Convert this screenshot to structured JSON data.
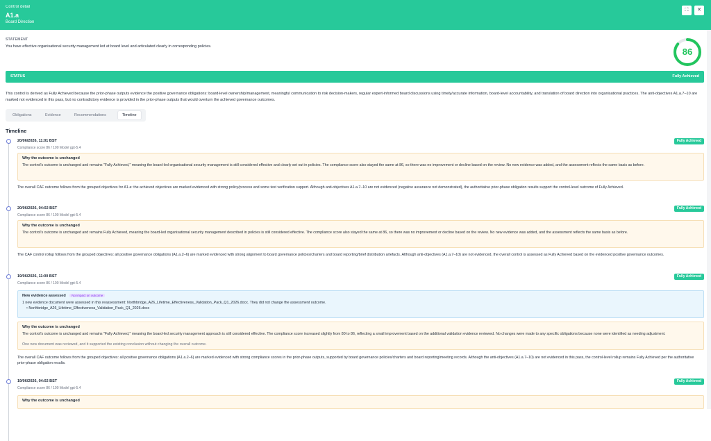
{
  "header": {
    "kicker": "Control detail",
    "title": "A1.a",
    "subtitle": "Board Direction",
    "expand_icon": "expand-icon",
    "close_icon": "close-icon"
  },
  "statement": {
    "label": "STATEMENT",
    "text": "You have effective organisational security management led at board level and articulated clearly in corresponding policies."
  },
  "score": {
    "value": "86",
    "fraction": 0.86,
    "color": "#22c55e"
  },
  "status": {
    "label": "STATUS",
    "value": "Fully Achieved"
  },
  "summary": "This control is derived as Fully Achieved because the prior-phase outputs evidence the positive governance obligations: board-level ownership/management, meaningful communication to risk decision-makers, regular expert-informed board discussions using timely/accurate information, board-level accountability, and translation of board direction into organisational practices. The anti-objectives A1.a.7–10 are marked not evidenced in this pass, but no contradictory evidence is provided in the prior-phase outputs that would overturn the achieved governance outcomes.",
  "tabs": [
    "Obligations",
    "Evidence",
    "Recommendations",
    "Timeline"
  ],
  "timeline_title": "Timeline",
  "entries": [
    {
      "date": "20/06/2026, 11:01 BST",
      "meta": "Compliance score 86 / 100  Model gpt-5.4",
      "badge": "Fully Achieved",
      "why_title": "Why the outcome is unchanged",
      "why_text": "The control's outcome is unchanged and remains \"Fully Achieved,\" meaning the board-led organisational security management is still considered effective and clearly set out in policies. The compliance score also stayed the same at 86, so there was no improvement or decline based on the review. No new evidence was added, and the assessment reflects the same basis as before.",
      "text": "The overall CAF outcome follows from the grouped objectives for A1.a: the achieved objectives are marked evidenced with strong policy/process and some test verification support. Although anti-objectives A1.a.7–10 are not evidenced (negative assurance not demonstrated), the authoritative prior-phase obligation results support the control-level outcome of Fully Achieved."
    },
    {
      "date": "20/06/2026, 04:02 BST",
      "meta": "Compliance score 86 / 100  Model gpt-5.4",
      "badge": "Fully Achieved",
      "why_title": "Why the outcome is unchanged",
      "why_text": "The control's outcome is unchanged and remains Fully Achieved, meaning the board-led organisational security management described in policies is still considered effective. The compliance score also stayed the same at 86, so there was no improvement or decline based on the review. No new evidence was added, and the assessment reflects the same basis as before.",
      "text": "The CAF control rollup follows from the grouped objectives: all positive governance obligations (A1.a.2–6) are marked evidenced with strong alignment to board governance policies/charters and board reporting/brief distribution artefacts. Although anti-objectives (A1.a.7–10) are not evidenced, the overall control is assessed as Fully Achieved based on the evidenced positive governance outcomes."
    },
    {
      "date": "19/06/2026, 11:00 BST",
      "meta": "Compliance score 86 / 100  Model gpt-5.4",
      "badge": "Fully Achieved",
      "new_title": "New evidence assessed",
      "new_pill": "No impact on outcome",
      "new_text": "1 new evidence document were assessed in this reassessment: Northbridge_A26_Lifetime_Effectiveness_Validation_Pack_Q1_2026.docx. They did not change the assessment outcome.",
      "new_file": "Northbridge_A26_Lifetime_Effectiveness_Validation_Pack_Q1_2026.docx",
      "why_title": "Why the outcome is unchanged",
      "why_text": "The control's outcome is unchanged and remains \"Fully Achieved,\" meaning the board-led security management approach is still considered effective. The compliance score increased slightly from 80 to 86, reflecting a small improvement based on the additional validation evidence reviewed. No changes were made to any specific obligations because none were identified as needing adjustment.",
      "why_note": "One new document was reviewed, and it supported the existing conclusion without changing the overall outcome.",
      "text": "The overall CAF outcome follows from the grouped objectives: all positive governance obligations (A1.a.2–6) are marked evidenced with strong compliance scores in the prior-phase outputs, supported by board governance policies/charters and board reporting/meeting records. Although the anti-objectives (A1.a.7–10) are not evidenced in this pass, the control-level rollup remains Fully Achieved per the authoritative prior-phase obligation results."
    },
    {
      "date": "19/06/2026, 04:02 BST",
      "meta": "Compliance score 86 / 100  Model gpt-5.4",
      "badge": "Fully Achieved",
      "why_title": "Why the outcome is unchanged"
    }
  ]
}
